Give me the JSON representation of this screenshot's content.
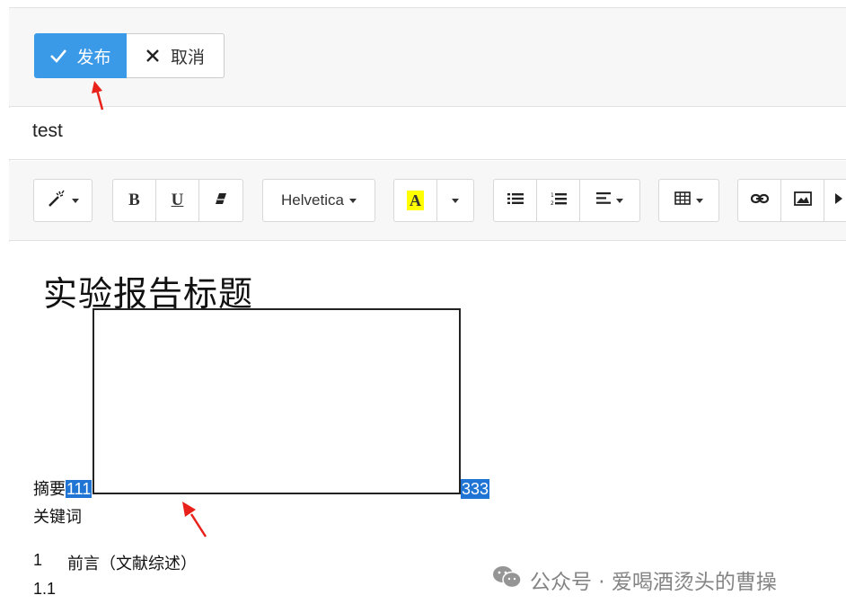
{
  "top_bar": {
    "publish_label": "发布",
    "cancel_label": "取消"
  },
  "title_field": {
    "value": "test"
  },
  "toolbar": {
    "font_name": "Helvetica",
    "bold": "B",
    "underline": "U",
    "highlight_letter": "A",
    "icons": [
      "magic-wand-icon",
      "bold-icon",
      "underline-icon",
      "eraser-icon",
      "font-family-dropdown",
      "highlight-color-icon",
      "unordered-list-icon",
      "ordered-list-icon",
      "align-icon",
      "table-icon",
      "link-icon",
      "image-icon",
      "video-icon"
    ]
  },
  "document": {
    "heading": "实验报告标题",
    "abstract_label": "摘要",
    "sel_left": "111",
    "sel_right": "333",
    "keywords_label": "关键词",
    "section1_num": "1",
    "section1_text": "前言（文献综述）",
    "section11_num": "1.1"
  },
  "watermark": {
    "text": "公众号 · 爱喝酒烫头的曹操"
  },
  "colors": {
    "primary": "#3a9ae8",
    "selection": "#1f74d4",
    "highlight": "#ffff00",
    "annotation_arrow": "#e8221b"
  }
}
